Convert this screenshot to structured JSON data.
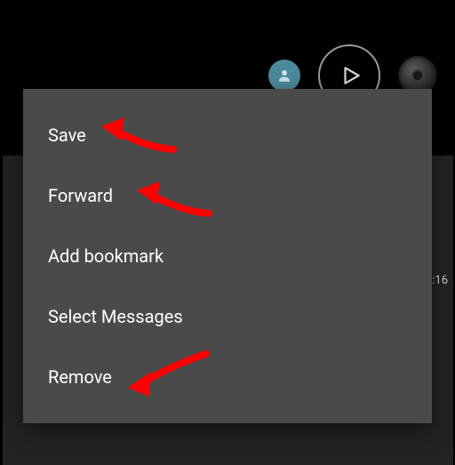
{
  "menu": {
    "items": [
      {
        "label": "Save"
      },
      {
        "label": "Forward"
      },
      {
        "label": "Add bookmark"
      },
      {
        "label": "Select Messages"
      },
      {
        "label": "Remove"
      }
    ]
  },
  "timestamp": ":16",
  "icons": {
    "avatar": "person-icon",
    "play": "play-icon",
    "thumb": "disc-thumbnail"
  },
  "annotation_arrows": [
    {
      "target": "save"
    },
    {
      "target": "forward"
    },
    {
      "target": "remove"
    }
  ]
}
